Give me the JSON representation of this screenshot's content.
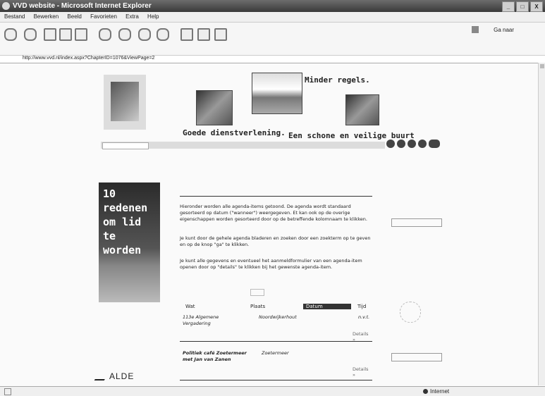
{
  "window": {
    "title": "VVD website - Microsoft Internet Explorer",
    "controls": [
      "_",
      "□",
      "X"
    ]
  },
  "menu": [
    "Bestand",
    "Bewerken",
    "Beeld",
    "Favorieten",
    "Extra",
    "Help"
  ],
  "toolbar": {
    "go_label": "Ga naar"
  },
  "address": {
    "url": "http://www.vvd.nl/index.aspx?ChapterID=1076&ViewPage=2"
  },
  "header": {
    "tagline_top": "Minder regels.",
    "tagline_left": "Goede dienstverlening.",
    "tagline_right": "Een schone en veilige buurt"
  },
  "banner": {
    "lines": [
      "10 redenen",
      "om lid",
      "te worden"
    ]
  },
  "sponsor": {
    "name": "ALDE"
  },
  "main": {
    "paragraphs": [
      "Hieronder worden alle agenda-items getoond. De agenda wordt standaard gesorteerd op datum (\"wanneer\") weergegeven. Et kan ook op de overige eigenschappen worden gesorteerd door op de betreffende kolomnaam te klikken.",
      "Je kunt door de gehele agenda bladeren en zoeken door een zoekterm op te geven en op de knop \"ga\" te klikken.",
      "Je kunt alle gegevens en eventueel het aanmeldformulier van een agenda-item openen door op \"details\" te klikken bij het gewenste agenda-item."
    ],
    "columns": [
      "Wat",
      "Plaats",
      "Datum",
      "Tijd"
    ],
    "rows": [
      {
        "what": [
          "113e Algemene",
          "Vergadering"
        ],
        "where": "Noordwijkerhout",
        "time": "n.v.t.",
        "details": "Details »"
      },
      {
        "what": [
          "Politiek café Zoetermeer",
          "met Jan van Zanen"
        ],
        "where": "Zoetermeer",
        "time": "",
        "details": "Details »"
      }
    ]
  },
  "status": {
    "zone": "Internet"
  }
}
